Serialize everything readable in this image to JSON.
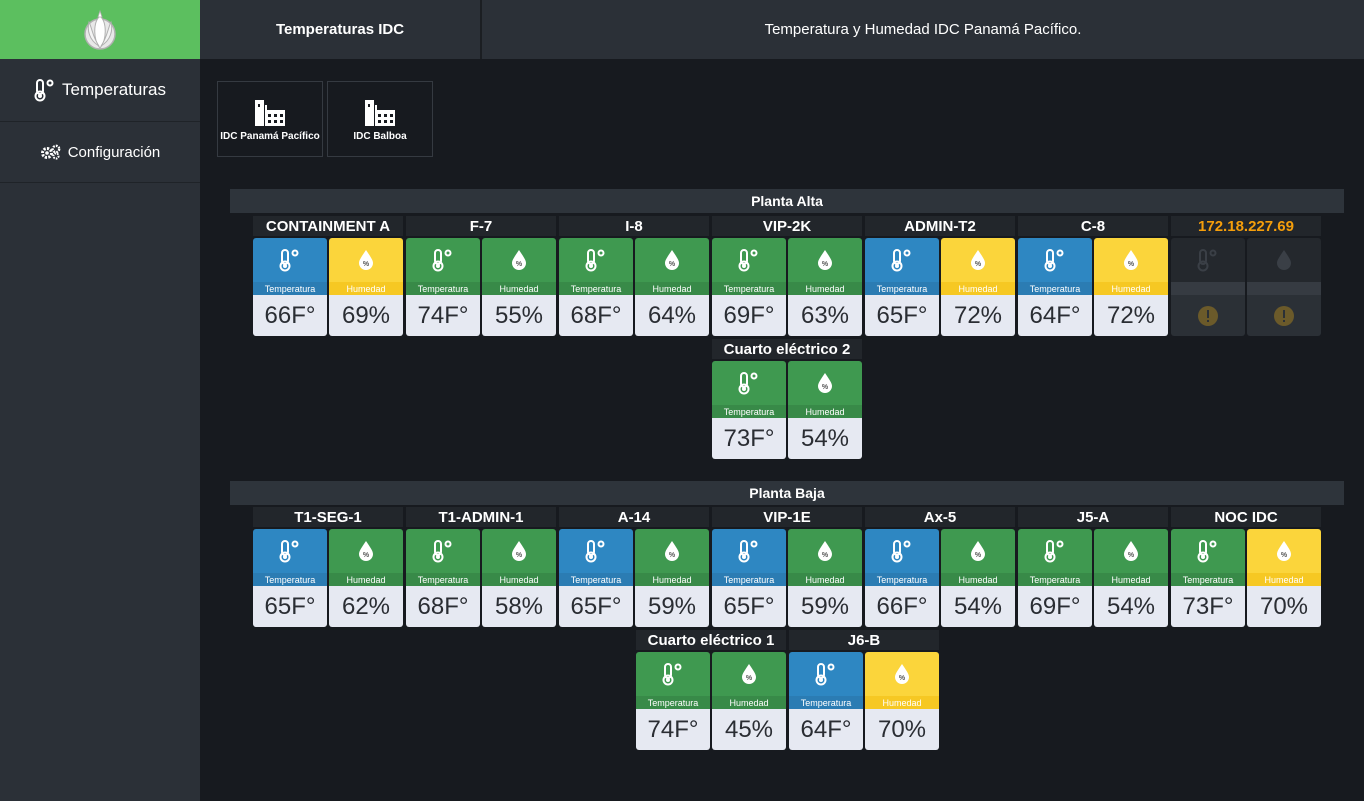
{
  "sidebar": {
    "items": [
      {
        "label": "Temperaturas"
      },
      {
        "label": "Configuración"
      }
    ]
  },
  "header": {
    "tab": "Temperaturas IDC",
    "title": "Temperatura y Humedad IDC Panamá Pacífico."
  },
  "sites": [
    {
      "label": "IDC Panamá Pacífico"
    },
    {
      "label": "IDC Balboa"
    }
  ],
  "labels": {
    "temp": "Temperatura",
    "hum": "Humedad"
  },
  "colors": {
    "blue": "#2e87c2",
    "green": "#3f9950",
    "yellow": "#fbd53b",
    "accent": "#5cbf5f",
    "warn": "#f59e0b"
  },
  "sections": [
    {
      "title": "Planta Alta",
      "rooms": [
        {
          "name": "CONTAINMENT A",
          "temp": "66F°",
          "hum": "69%",
          "temp_color": "blue",
          "hum_color": "yellow"
        },
        {
          "name": "F-7",
          "temp": "74F°",
          "hum": "55%",
          "temp_color": "green",
          "hum_color": "green"
        },
        {
          "name": "I-8",
          "temp": "68F°",
          "hum": "64%",
          "temp_color": "green",
          "hum_color": "green"
        },
        {
          "name": "VIP-2K",
          "temp": "69F°",
          "hum": "63%",
          "temp_color": "green",
          "hum_color": "green"
        },
        {
          "name": "ADMIN-T2",
          "temp": "65F°",
          "hum": "72%",
          "temp_color": "blue",
          "hum_color": "yellow"
        },
        {
          "name": "C-8",
          "temp": "64F°",
          "hum": "72%",
          "temp_color": "blue",
          "hum_color": "yellow"
        },
        {
          "name": "172.18.227.69",
          "temp": "",
          "hum": "",
          "temp_color": "off",
          "hum_color": "off",
          "offline": true
        },
        {
          "name": "Cuarto eléctrico 2",
          "temp": "73F°",
          "hum": "54%",
          "temp_color": "green",
          "hum_color": "green"
        }
      ]
    },
    {
      "title": "Planta Baja",
      "rooms": [
        {
          "name": "T1-SEG-1",
          "temp": "65F°",
          "hum": "62%",
          "temp_color": "blue",
          "hum_color": "green"
        },
        {
          "name": "T1-ADMIN-1",
          "temp": "68F°",
          "hum": "58%",
          "temp_color": "green",
          "hum_color": "green"
        },
        {
          "name": "A-14",
          "temp": "65F°",
          "hum": "59%",
          "temp_color": "blue",
          "hum_color": "green"
        },
        {
          "name": "VIP-1E",
          "temp": "65F°",
          "hum": "59%",
          "temp_color": "blue",
          "hum_color": "green"
        },
        {
          "name": "Ax-5",
          "temp": "66F°",
          "hum": "54%",
          "temp_color": "blue",
          "hum_color": "green"
        },
        {
          "name": "J5-A",
          "temp": "69F°",
          "hum": "54%",
          "temp_color": "green",
          "hum_color": "green"
        },
        {
          "name": "NOC IDC",
          "temp": "73F°",
          "hum": "70%",
          "temp_color": "green",
          "hum_color": "yellow"
        },
        {
          "name": "Cuarto eléctrico 1",
          "temp": "74F°",
          "hum": "45%",
          "temp_color": "green",
          "hum_color": "green"
        },
        {
          "name": "J6-B",
          "temp": "64F°",
          "hum": "70%",
          "temp_color": "blue",
          "hum_color": "yellow"
        }
      ]
    }
  ]
}
